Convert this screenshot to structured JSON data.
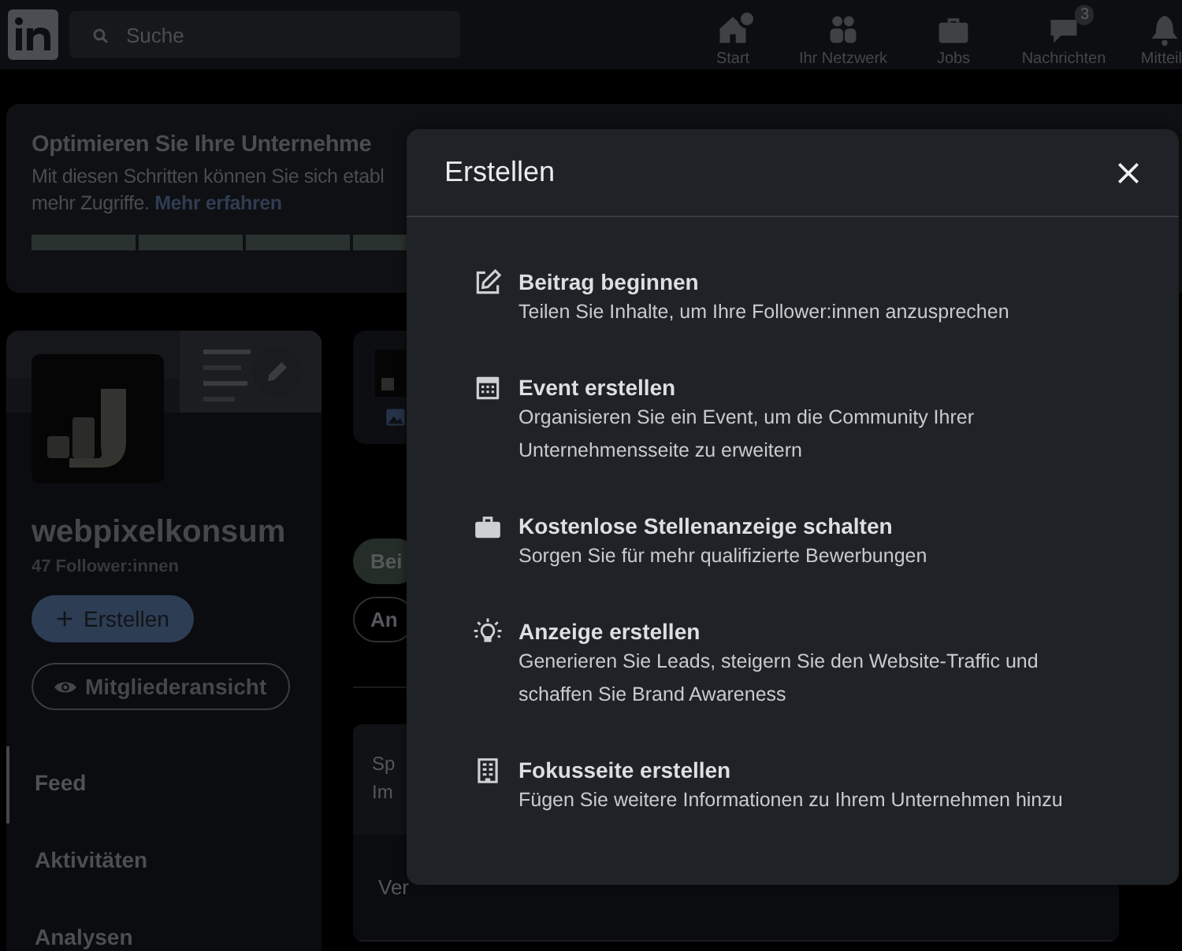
{
  "header": {
    "search": {
      "placeholder": "Suche"
    },
    "nav": [
      {
        "label": "Start",
        "dot": true
      },
      {
        "label": "Ihr Netzwerk"
      },
      {
        "label": "Jobs"
      },
      {
        "label": "Nachrichten",
        "badge": "3"
      },
      {
        "label": "Mitteil"
      }
    ]
  },
  "banner": {
    "title": "Optimieren Sie Ihre Unternehme",
    "text_line_1": "Mit diesen Schritten können Sie sich etabl",
    "text_line_2": "mehr Zugriffe.",
    "link": "Mehr erfahren"
  },
  "profile": {
    "name": "webpixelkonsum",
    "followers": "47 Follower:innen",
    "create_button": "Erstellen",
    "member_view_button": "Mitgliederansicht",
    "menu": [
      {
        "label": "Feed",
        "selected": true
      },
      {
        "label": "Aktivitäten",
        "selected": false
      },
      {
        "label": "Analysen",
        "selected": false
      }
    ]
  },
  "middle": {
    "pills": [
      {
        "label": "Bei",
        "selected": true
      },
      {
        "label": "An",
        "selected": false
      }
    ],
    "card_lines": [
      "Sp",
      "Im"
    ],
    "row": "Ver"
  },
  "modal": {
    "title": "Erstellen",
    "items": [
      {
        "title": "Beitrag beginnen",
        "description": "Teilen Sie Inhalte, um Ihre Follower:innen anzusprechen"
      },
      {
        "title": "Event erstellen",
        "description": "Organisieren Sie ein Event, um die Community Ihrer Unternehmensseite zu erweitern"
      },
      {
        "title": "Kostenlose Stellenanzeige schalten",
        "description": "Sorgen Sie für mehr qualifizierte Bewerbungen"
      },
      {
        "title": "Anzeige erstellen",
        "description": "Generieren Sie Leads, steigern Sie den Website-Traffic und schaffen Sie Brand Awareness"
      },
      {
        "title": "Fokusseite erstellen",
        "description": "Fügen Sie weitere Informationen zu Ihrem Unternehmen hinzu"
      }
    ]
  }
}
